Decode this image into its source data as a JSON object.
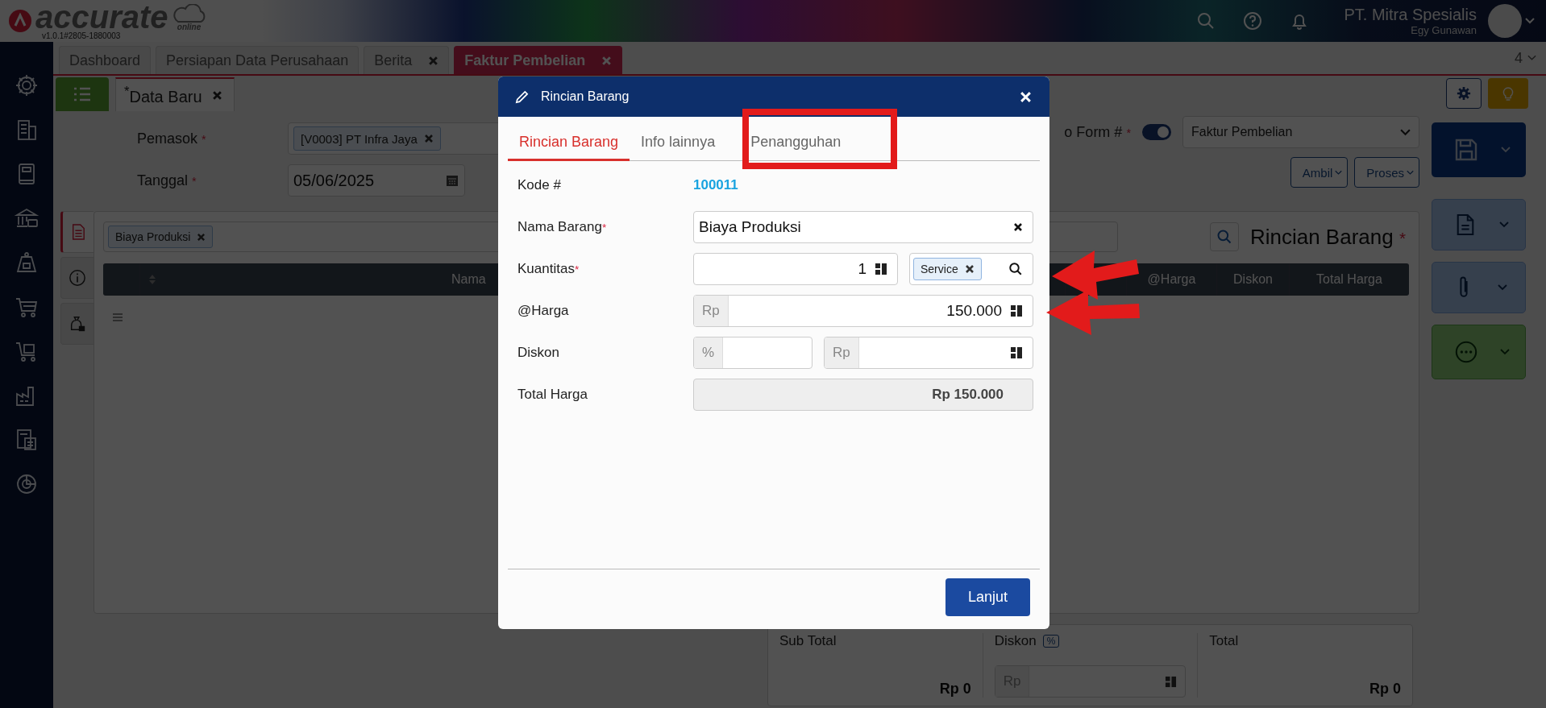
{
  "header": {
    "brand": "accurate",
    "brand_sub": "online",
    "version": "v1.0.1#2805-1880003",
    "company": "PT. Mitra Spesialis",
    "user": "Egy Gunawan"
  },
  "tabs": [
    {
      "label": "Dashboard",
      "closable": false,
      "selected": false
    },
    {
      "label": "Persiapan Data Perusahaan",
      "closable": false,
      "selected": false
    },
    {
      "label": "Berita",
      "closable": true,
      "selected": false
    },
    {
      "label": "Faktur Pembelian",
      "closable": true,
      "selected": true
    }
  ],
  "tab_count": "4",
  "doc_tab": {
    "label": "$^{*}$Data Baru",
    "selected": true
  },
  "form": {
    "supplier": {
      "label": "Pemasok",
      "mark": "*",
      "value": "[V0003] PT Infra Jaya"
    },
    "date": {
      "label": "Tanggal",
      "mark": "*",
      "value": "05/06/2025"
    },
    "form_no": {
      "label": "o Form #",
      "mark": "*",
      "on": true,
      "type": "Faktur Pembelian"
    },
    "buttons": [
      "Ambil",
      "Proses"
    ]
  },
  "panel": {
    "side_tabs": [
      {
        "selected": true
      },
      {
        "selected": false
      },
      {
        "selected": false
      }
    ],
    "filter_tag": "Biaya Produksi",
    "title": "Rincian Barang",
    "title_mark": "*",
    "columns": [
      "Nama",
      "@Harga",
      "Diskon",
      "Total Harga"
    ]
  },
  "summary": {
    "subtotal_label": "Sub Total",
    "subtotal": "Rp 0",
    "discount_label": "Diskon",
    "discount_unit": "%",
    "discount_prefix": "Rp",
    "total_label": "Total",
    "total": "Rp 0"
  },
  "dialog": {
    "title": "Rincian Barang",
    "tabs": [
      {
        "label": "Rincian Barang",
        "selected": true
      },
      {
        "label": "Info lainnya",
        "selected": false
      },
      {
        "label": "Penangguhan",
        "selected": false
      }
    ],
    "fields": [
      {
        "kind": "text",
        "label": "Kode #",
        "value": "100011"
      },
      {
        "kind": "select",
        "label": "Nama Barang",
        "mark": "*",
        "value": "Biaya Produksi"
      },
      {
        "kind": "quantity",
        "label": "Kuantitas",
        "mark": "*",
        "value": "1",
        "unit": "Service"
      },
      {
        "kind": "money",
        "label": "@Harga",
        "prefix": "Rp",
        "value": "150.000"
      },
      {
        "kind": "discount",
        "label": "Diskon",
        "percent_prefix": "%",
        "prefix": "Rp"
      },
      {
        "kind": "total",
        "label": "Total Harga",
        "value": "Rp 150.000"
      }
    ],
    "button": "Lanjut"
  },
  "annotations": [
    {
      "kind": "frame"
    },
    {
      "kind": "arrow"
    },
    {
      "kind": "arrow"
    }
  ]
}
